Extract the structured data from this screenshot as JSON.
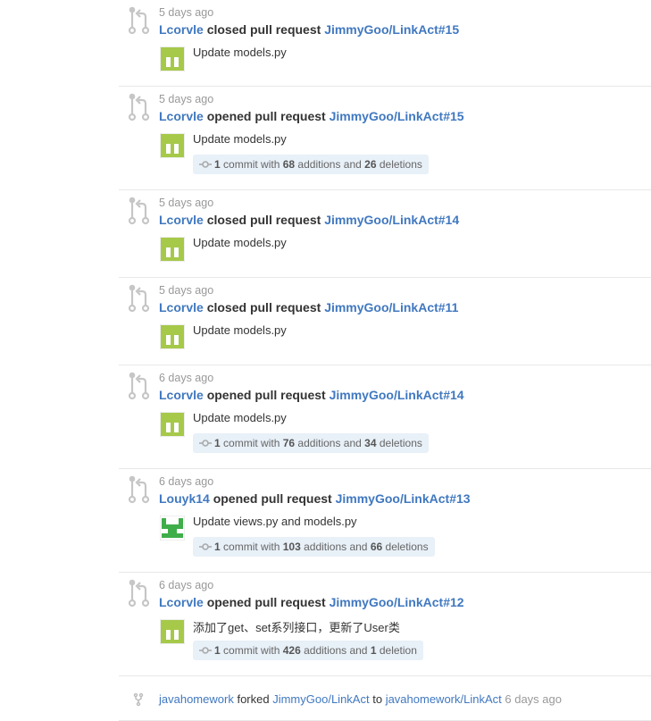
{
  "colors": {
    "link": "#4078c0",
    "muted": "#999999",
    "commit_bg": "#e8f0f8",
    "avatar_green": "#a6c94a"
  },
  "events": [
    {
      "time": "5 days ago",
      "actor": "Lcorvle",
      "action": "closed pull request",
      "target": "JimmyGoo/LinkAct#15",
      "message": "Update models.py",
      "avatar": "green-block-avatar",
      "commits": null
    },
    {
      "time": "5 days ago",
      "actor": "Lcorvle",
      "action": "opened pull request",
      "target": "JimmyGoo/LinkAct#15",
      "message": "Update models.py",
      "avatar": "green-block-avatar",
      "commits": {
        "count": "1",
        "with": "commit with",
        "additions": "68",
        "add_label": "additions and",
        "deletions": "26",
        "del_label": "deletions"
      }
    },
    {
      "time": "5 days ago",
      "actor": "Lcorvle",
      "action": "closed pull request",
      "target": "JimmyGoo/LinkAct#14",
      "message": "Update models.py",
      "avatar": "green-block-avatar",
      "commits": null
    },
    {
      "time": "5 days ago",
      "actor": "Lcorvle",
      "action": "closed pull request",
      "target": "JimmyGoo/LinkAct#11",
      "message": "Update models.py",
      "avatar": "green-block-avatar",
      "commits": null
    },
    {
      "time": "6 days ago",
      "actor": "Lcorvle",
      "action": "opened pull request",
      "target": "JimmyGoo/LinkAct#14",
      "message": "Update models.py",
      "avatar": "green-block-avatar",
      "commits": {
        "count": "1",
        "with": "commit with",
        "additions": "76",
        "add_label": "additions and",
        "deletions": "34",
        "del_label": "deletions"
      }
    },
    {
      "time": "6 days ago",
      "actor": "Louyk14",
      "action": "opened pull request",
      "target": "JimmyGoo/LinkAct#13",
      "message": "Update views.py and models.py",
      "avatar": "green-pattern-avatar",
      "commits": {
        "count": "1",
        "with": "commit with",
        "additions": "103",
        "add_label": "additions and",
        "deletions": "66",
        "del_label": "deletions"
      }
    },
    {
      "time": "6 days ago",
      "actor": "Lcorvle",
      "action": "opened pull request",
      "target": "JimmyGoo/LinkAct#12",
      "message": "添加了get、set系列接口，更新了User类",
      "avatar": "green-block-avatar",
      "commits": {
        "count": "1",
        "with": "commit with",
        "additions": "426",
        "add_label": "additions and",
        "deletions": "1",
        "del_label": "deletion"
      }
    }
  ],
  "fork": {
    "actor": "javahomework",
    "action": "forked",
    "source": "JimmyGoo/LinkAct",
    "to": "to",
    "dest": "javahomework/LinkAct",
    "time": "6 days ago"
  }
}
